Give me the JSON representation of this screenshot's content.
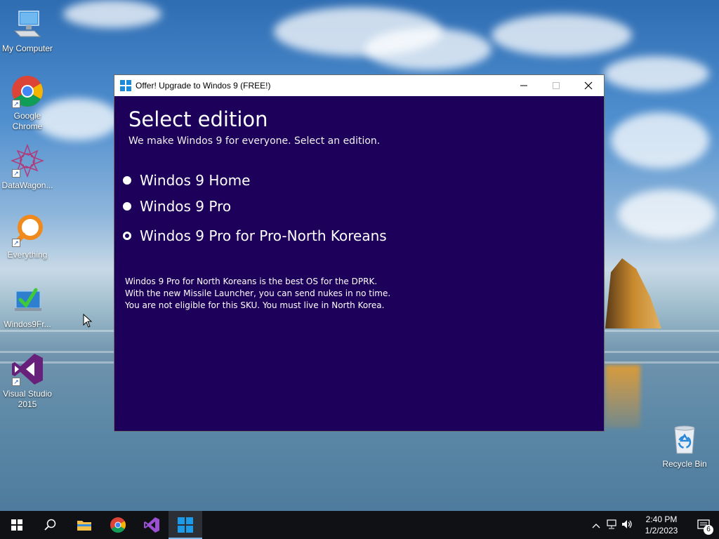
{
  "desktop": {
    "icons": [
      {
        "label": "My Computer"
      },
      {
        "label": "Google Chrome"
      },
      {
        "label": "DataWagon..."
      },
      {
        "label": "Everything"
      },
      {
        "label": "Windos9Fr..."
      },
      {
        "label": "Visual Studio 2015"
      },
      {
        "label": "Recycle Bin"
      }
    ]
  },
  "window": {
    "title": "Offer! Upgrade to Windos 9 (FREE!)",
    "heading": "Select edition",
    "subheading": "We make Windos 9 for everyone. Select an edition.",
    "options": [
      {
        "label": "Windos 9 Home",
        "selected": false
      },
      {
        "label": "Windos 9 Pro",
        "selected": false
      },
      {
        "label": "Windos 9 Pro for Pro-North Koreans",
        "selected": true
      }
    ],
    "description": [
      "Windos 9 Pro for North Koreans is the best OS for the DPRK.",
      "With the new Missile Launcher, you can send nukes in no time.",
      "You are not eligible for this SKU. You must live in North Korea."
    ],
    "background_color": "#1c0059"
  },
  "taskbar": {
    "time": "2:40 PM",
    "date": "1/2/2023",
    "notification_count": "6"
  }
}
